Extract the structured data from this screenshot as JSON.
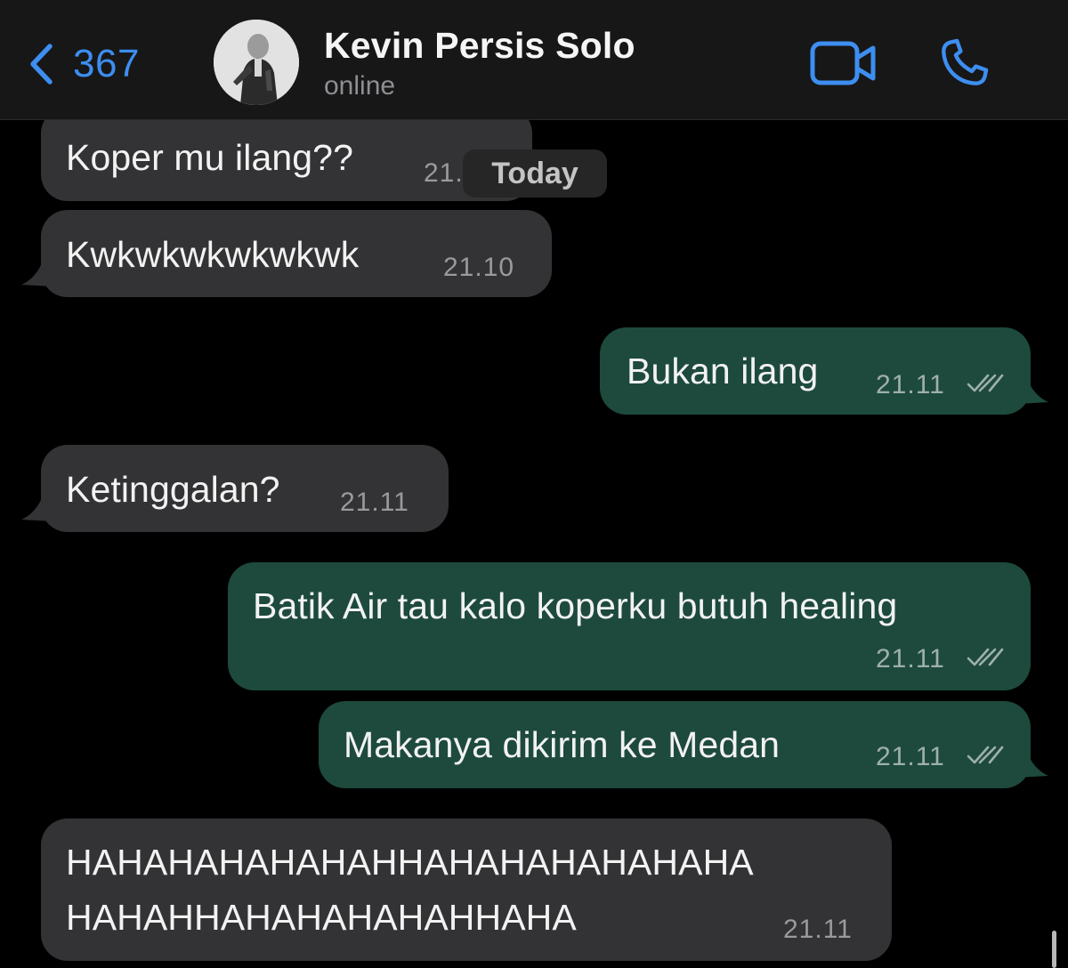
{
  "header": {
    "back_count": "367",
    "contact_name": "Kevin Persis Solo",
    "status": "online",
    "icons": {
      "back": "chevron-left-icon",
      "video": "video-camera-icon",
      "phone": "phone-icon"
    },
    "accent_color": "#3d8ef0"
  },
  "date_separator": "Today",
  "colors": {
    "incoming_bubble": "#333335",
    "outgoing_bubble": "#1d4a3d",
    "background": "#000000"
  },
  "messages": [
    {
      "direction": "incoming",
      "text": "Koper mu ilang??",
      "time": "21.1"
    },
    {
      "direction": "incoming",
      "text": "Kwkwkwkwkwkwk",
      "time": "21.10"
    },
    {
      "direction": "outgoing",
      "text": "Bukan ilang",
      "time": "21.11",
      "status": "read"
    },
    {
      "direction": "incoming",
      "text": "Ketinggalan?",
      "time": "21.11"
    },
    {
      "direction": "outgoing",
      "text": "Batik Air tau kalo koperku butuh healing",
      "time": "21.11",
      "status": "read"
    },
    {
      "direction": "outgoing",
      "text": "Makanya dikirim ke Medan",
      "time": "21.11",
      "status": "read"
    },
    {
      "direction": "incoming",
      "text_lines": [
        "HAHAHAHAHAHAHHAHAHAHAHAHAHA",
        "HAHAHHAHAHAHAHAHHAHA"
      ],
      "time": "21.11"
    }
  ]
}
